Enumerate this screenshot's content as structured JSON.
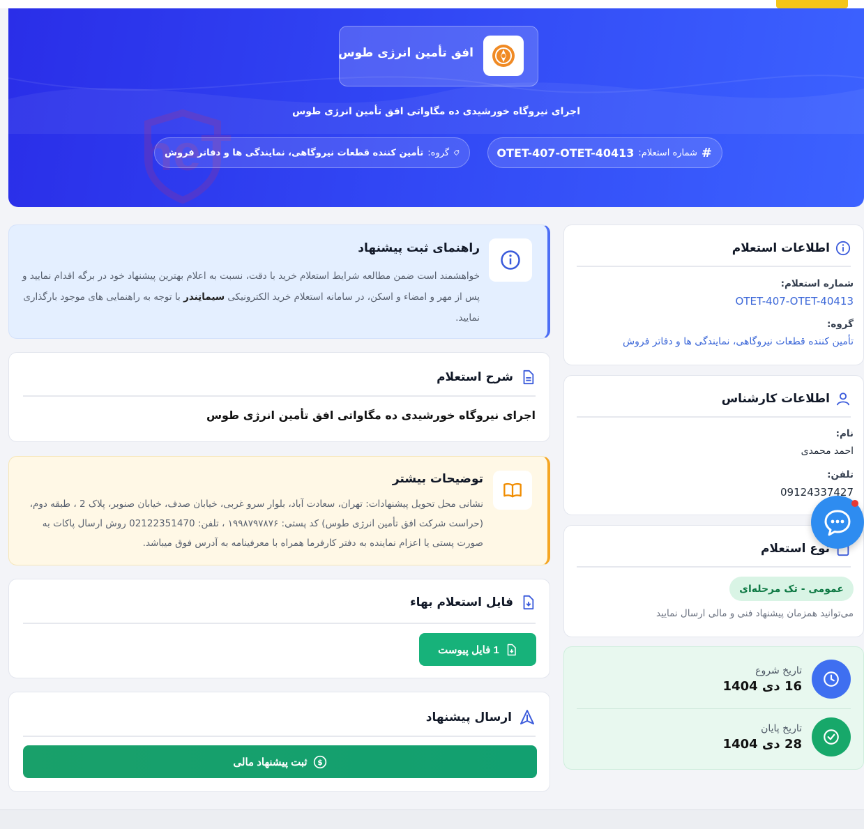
{
  "header": {
    "brand_name": "افق تأمین انرژی طوس",
    "subtitle": "اجرای نیروگاه خورشیدی ده مگاواتی افق تأمین انرژی طوس",
    "id_label": "شماره استعلام:",
    "id_value": "OTET-407-OTET-40413",
    "group_label": "گروه:",
    "group_value": "تأمین کننده قطعات نیروگاهی، نمایندگی ها و دفاتر فروش",
    "watermark_text": "AriaTender.neT"
  },
  "guide": {
    "title": "راهنمای ثبت پیشنهاد",
    "text_part1": "خواهشمند است ضمن مطالعه شرایط استعلام خرید با دقت، نسبت به اعلام بهترین پیشنهاد خود در برگه اقدام نمایید و پس از مهر و امضاء و اسکن، در سامانه استعلام خرید الکترونیکی ",
    "brand_bold": "سیماتِندر",
    "text_part2": " با توجه به راهنمایی های موجود بارگذاری نمایید."
  },
  "description": {
    "title": "شرح استعلام",
    "body": "اجرای نیروگاه خورشیدی ده مگاواتی افق تأمین انرژی طوس"
  },
  "more_info": {
    "title": "توضیحات بیشتر",
    "text": "نشانی محل تحویل پیشنهادات: تهران، سعادت آباد، بلوار سرو غربی، خیابان صدف، خیابان صنوبر، پلاک 2 ، طبقه دوم، (حراست شرکت افق تأمین انرژی طوس) کد پستی: ۱۹۹۸۷۹۷۸۷۶ ، تلفن: 02122351470 روش ارسال پاکات به صورت پستی یا اعزام نماینده به دفتر کارفرما همراه با معرفینامه به آدرس فوق میباشد."
  },
  "files": {
    "title": "فایل استعلام بهاء",
    "button_label": "1 فایل پیوست"
  },
  "submit": {
    "title": "ارسال پیشنهاد",
    "button_label": "ثبت پیشنهاد مالی"
  },
  "inquiry_info": {
    "title": "اطلاعات استعلام",
    "number_label": "شماره استعلام:",
    "number_value": "OTET-407-OTET-40413",
    "group_label": "گروه:",
    "group_value": "تأمین کننده قطعات نیروگاهی، نمایندگی ها و دفاتر فروش"
  },
  "expert_info": {
    "title": "اطلاعات کارشناس",
    "name_label": "نام:",
    "name_value": "احمد محمدی",
    "phone_label": "تلفن:",
    "phone_value": "09124337427"
  },
  "inquiry_type": {
    "title": "نوع استعلام",
    "badge": "عمومی - تک مرحله‌ای",
    "note": "می‌توانید همزمان پیشنهاد فنی و مالی ارسال نمایید"
  },
  "dates": {
    "start_label": "تاریخ شروع",
    "start_value": "16 دی 1404",
    "end_label": "تاریخ پایان",
    "end_value": "28 دی 1404"
  },
  "colors": {
    "hero_blue": "#3146f4",
    "accent_yellow": "#f5c518",
    "green": "#17b27a",
    "link_blue": "#3b67d8",
    "warning_orange": "#f5a623"
  }
}
